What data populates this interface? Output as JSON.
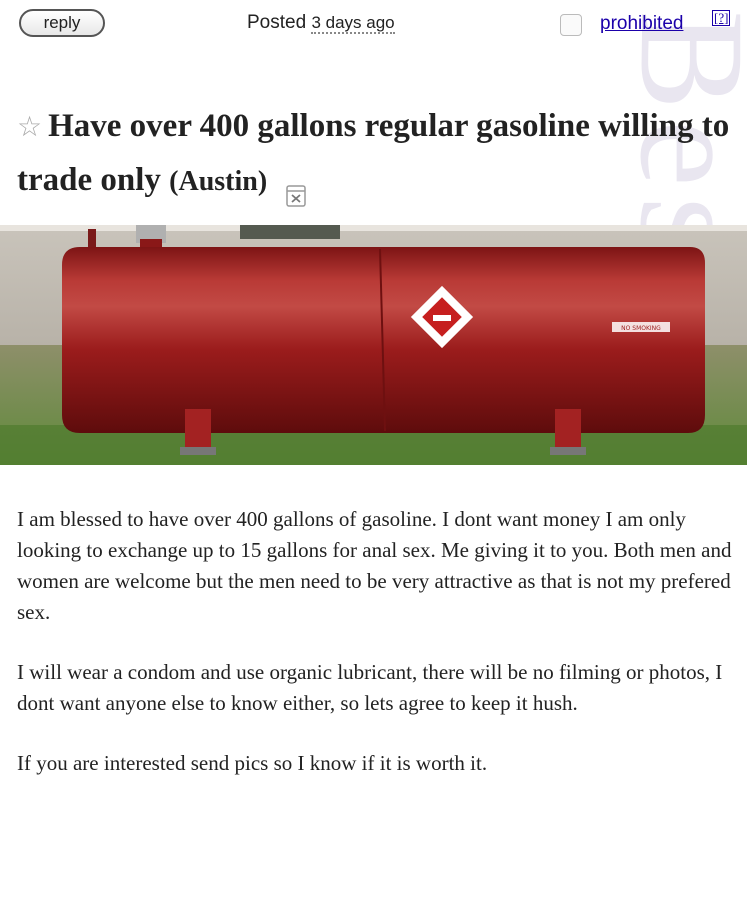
{
  "header": {
    "reply_label": "reply",
    "posted_label": "Posted",
    "posted_time": "3 days ago",
    "prohibited_label": "prohibited",
    "help_label": "[?]"
  },
  "post": {
    "title": "Have over 400 gallons regular gasoline willing to trade only",
    "location": "(Austin)",
    "image_alt": "large red fuel storage tank with diamond flammable placard",
    "tank_sign": "NO SMOKING",
    "body": [
      "I am blessed to have over 400 gallons of gasoline. I dont want money I am only looking to exchange up to 15 gallons for anal sex. Me giving it to you. Both men and women are welcome but the men need to be very attractive as that is not my prefered sex.",
      "I will wear a condom and use organic lubricant, there will be no filming or photos, I dont want anyone else to know either, so lets agree to keep it hush.",
      "If you are interested send pics so I know if it is worth it."
    ]
  },
  "icons": {
    "star": "star-icon",
    "hide": "hide-posting-icon",
    "flag_checkbox": "flag-checkbox"
  },
  "colors": {
    "link": "#1b00aa",
    "tank": "#9b1c1c",
    "grass": "#5f8a3a"
  }
}
